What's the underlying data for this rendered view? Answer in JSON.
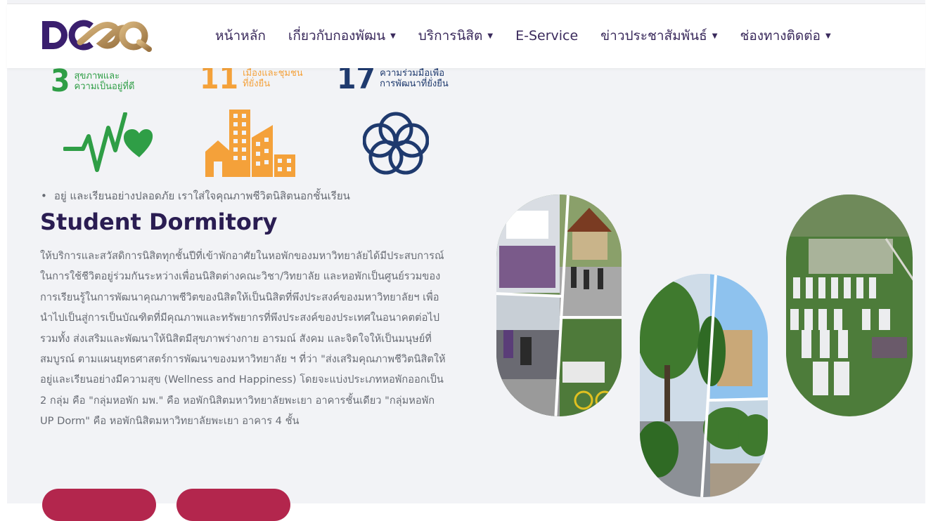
{
  "brand": {
    "logo_text": "DCQQ",
    "colors": {
      "purple": "#3a1f6e",
      "gold": "#b8935a",
      "green": "#2f9e46",
      "orange": "#f4a13a",
      "navy": "#1f3a6e",
      "crimson": "#b3264d"
    }
  },
  "nav": {
    "items": [
      {
        "label": "หน้าหลัก",
        "dropdown": false
      },
      {
        "label": "เกี่ยวกับกองพัฒน",
        "dropdown": true
      },
      {
        "label": "บริการนิสิต",
        "dropdown": true
      },
      {
        "label": "E-Service",
        "dropdown": false
      },
      {
        "label": "ข่าวประชาสัมพันธ์",
        "dropdown": true
      },
      {
        "label": "ช่องทางติดต่อ",
        "dropdown": true
      }
    ],
    "caret": "▼"
  },
  "sdgs": [
    {
      "num": "3",
      "line1": "สุขภาพและ",
      "line2": "ความเป็นอยู่ที่ดี",
      "icon": "heartbeat-icon"
    },
    {
      "num": "11",
      "line1": "เมืองและชุมชน",
      "line2": "ที่ยั่งยืน",
      "icon": "city-buildings-icon"
    },
    {
      "num": "17",
      "line1": "ความร่วมมือเพื่อ",
      "line2": "การพัฒนาที่ยั่งยืน",
      "icon": "partnership-rings-icon"
    }
  ],
  "content": {
    "bullet": "อยู่ และเรียนอย่างปลอดภัย เราใส่ใจคุณภาพชีวิตนิสิตนอกชั้นเรียน",
    "title": "Student Dormitory",
    "description": "ให้บริการและสวัสดิการนิสิตทุกชั้นปีที่เข้าพักอาศัยในหอพักของมหาวิทยาลัยได้มีประสบการณ์ในการใช้ชีวิตอยู่ร่วมกันระหว่างเพื่อนนิสิตต่างคณะวิชา/วิทยาลัย และหอพักเป็นศูนย์รวมของการเรียนรู้ในการพัฒนาคุณภาพชีวิตของนิสิตให้เป็นนิสิตที่พึงประสงค์ของมหาวิทยาลัยฯ เพื่อนำไปเป็นสู่การเป็นบัณฑิตที่มีคุณภาพและทรัพยากรที่พึงประสงค์ของประเทศในอนาคตต่อไป รวมทั้ง ส่งเสริมและพัฒนาให้นิสิตมีสุขภาพร่างกาย อารมณ์ สังคม และจิตใจให้เป็นมนุษย์ที่สมบูรณ์ ตามแผนยุทธศาสตร์การพัฒนาของมหาวิทยาลัย ฯ ที่ว่า \"ส่งเสริมคุณภาพชีวิตนิสิตให้อยู่และเรียนอย่างมีความสุข (Wellness and Happiness) โดยจะแบ่งประเภทหอพักออกเป็น 2 กลุ่ม คือ \"กลุ่มหอพัก มพ.\" คือ หอพักนิสิตมหาวิทยาลัยพะเยา อาคารชั้นเดียว \"กลุ่มหอพัก UP Dorm\" คือ หอพักนิสิตมหาวิทยาลัยพะเยา อาคาร 4 ชั้น"
  },
  "photos": [
    "photo-collage-students",
    "photo-collage-campus-trees",
    "photo-aerial-campus"
  ]
}
